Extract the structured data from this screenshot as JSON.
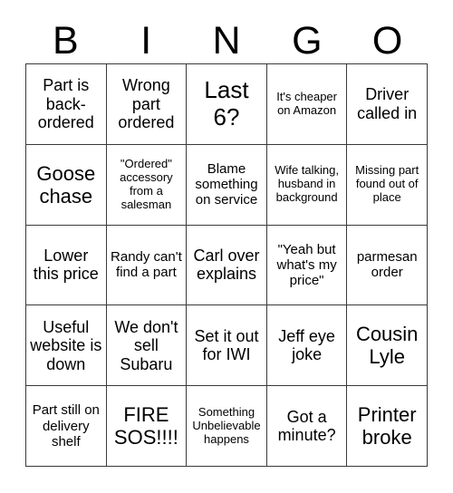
{
  "header": {
    "letters": [
      "B",
      "I",
      "N",
      "G",
      "O"
    ]
  },
  "grid": {
    "rows": 5,
    "columns": 5,
    "border_color": "#3a3a3a",
    "cell_background": "#ffffff",
    "text_color": "#000000",
    "cells": [
      {
        "text": "Part is back-ordered",
        "size": "md"
      },
      {
        "text": "Wrong part ordered",
        "size": "md"
      },
      {
        "text": "Last 6?",
        "size": "xl"
      },
      {
        "text": "It's cheaper on Amazon",
        "size": "xs"
      },
      {
        "text": "Driver called in",
        "size": "md"
      },
      {
        "text": "Goose chase",
        "size": "lg"
      },
      {
        "text": "\"Ordered\" accessory from a salesman",
        "size": "xs"
      },
      {
        "text": "Blame something on service",
        "size": "sm"
      },
      {
        "text": "Wife talking, husband in background",
        "size": "xs"
      },
      {
        "text": "Missing part found out of place",
        "size": "xs"
      },
      {
        "text": "Lower this price",
        "size": "md"
      },
      {
        "text": "Randy can't find a part",
        "size": "sm"
      },
      {
        "text": "Carl over explains",
        "size": "md"
      },
      {
        "text": "\"Yeah but what's my price\"",
        "size": "sm"
      },
      {
        "text": "parmesan order",
        "size": "sm"
      },
      {
        "text": "Useful website is down",
        "size": "md"
      },
      {
        "text": "We don't sell Subaru",
        "size": "md"
      },
      {
        "text": "Set it out for IWI",
        "size": "md"
      },
      {
        "text": "Jeff eye joke",
        "size": "md"
      },
      {
        "text": "Cousin Lyle",
        "size": "lg"
      },
      {
        "text": "Part still on delivery shelf",
        "size": "sm"
      },
      {
        "text": "FIRE SOS!!!!",
        "size": "lg"
      },
      {
        "text": "Something Unbelievable happens",
        "size": "xs"
      },
      {
        "text": "Got a minute?",
        "size": "md"
      },
      {
        "text": "Printer broke",
        "size": "lg"
      }
    ]
  }
}
